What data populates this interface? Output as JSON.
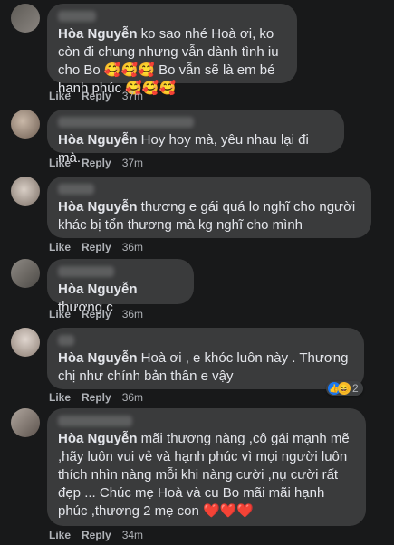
{
  "actions": {
    "like": "Like",
    "reply": "Reply"
  },
  "comments": [
    {
      "mention": "Hòa Nguyễn",
      "text": " ko sao nhé Hoà ơi, ko còn đi chung nhưng vẫn dành tình iu cho Bo 🥰🥰🥰 Bo vẫn sẽ là em bé hạnh phúc 🥰🥰🥰",
      "time": "37m"
    },
    {
      "mention": "Hòa Nguyễn",
      "text": " Hoy hoy mà, yêu nhau lại đi mà.",
      "time": "37m"
    },
    {
      "mention": "Hòa Nguyễn",
      "text": " thương e gái quá lo nghĩ cho người khác bị tổn thương mà kg nghĩ cho mình",
      "time": "36m"
    },
    {
      "mention": "Hòa Nguyễn",
      "text": " thương c",
      "time": "36m"
    },
    {
      "mention": "Hòa Nguyễn",
      "text": " Hoà ơi , e khóc luôn này . Thương chị như chính bản thân e vậy",
      "time": "36m",
      "reactions": {
        "count": "2",
        "icons": [
          "like-icon",
          "haha-icon"
        ]
      }
    },
    {
      "mention": "Hòa Nguyễn",
      "text": " mãi thương nàng ,cô gái mạnh mẽ ,hãy luôn vui vẻ và hạnh phúc vì mọi người luôn thích nhìn nàng mỗi khi nàng cười ,nụ cười rất đẹp ... Chúc mẹ Hoà và cu Bo mãi mãi hạnh phúc ,thương 2 mẹ con ❤️❤️❤️",
      "time": "34m"
    }
  ],
  "colors": {
    "background": "#18191a",
    "bubble": "#3a3b3c",
    "meta": "#b0b3b8",
    "like_blue": "#1877f2",
    "haha_yellow": "#f7b928"
  }
}
